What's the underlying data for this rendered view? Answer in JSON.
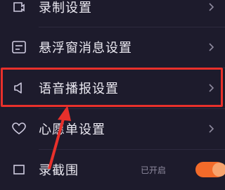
{
  "menu": {
    "items": [
      {
        "label": "录制设置",
        "icon": "record-settings-icon"
      },
      {
        "label": "悬浮窗消息设置",
        "icon": "floating-window-icon"
      },
      {
        "label": "语音播报设置",
        "icon": "speaker-icon"
      },
      {
        "label": "心愿单设置",
        "icon": "heart-icon"
      },
      {
        "label": "录截围",
        "icon": "crop-icon",
        "status": "已开启",
        "toggle_on": true
      }
    ]
  },
  "colors": {
    "background": "#1d1b2c",
    "highlight": "#e8302b",
    "arrow": "#e8302b",
    "toggle": "#f26b2a"
  }
}
